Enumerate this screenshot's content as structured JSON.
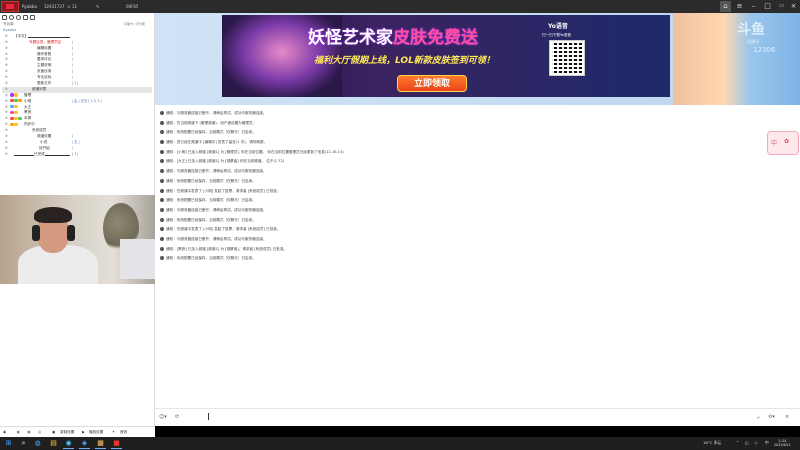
{
  "titlebar": {
    "app_name": "Ryabba",
    "channel_id": "32431737",
    "viewers": "11",
    "status_code": "00F65"
  },
  "left_panel": {
    "header_left": "节目单",
    "header_right": "平缓卡 | 不分离",
    "version": "Ryabba",
    "tree": [
      {
        "label": "【中文】",
        "indent": 12,
        "right": "",
        "red": false,
        "hl": false,
        "line": true
      },
      {
        "label": "专题目录，管理员区",
        "indent": 27,
        "right": "|",
        "red": true,
        "hl": false,
        "line": false
      },
      {
        "label": "编辑设置",
        "indent": 35,
        "right": "|",
        "red": false,
        "hl": false,
        "line": false
      },
      {
        "label": "操作参数",
        "indent": 35,
        "right": "|",
        "red": false,
        "hl": false,
        "line": false
      },
      {
        "label": "要求评论",
        "indent": 35,
        "right": "|",
        "red": false,
        "hl": false,
        "line": false
      },
      {
        "label": "主题说明",
        "indent": 35,
        "right": "|",
        "red": false,
        "hl": false,
        "line": false
      },
      {
        "label": "页面目录",
        "indent": 35,
        "right": "|",
        "red": false,
        "hl": false,
        "line": false
      },
      {
        "label": "专业目标",
        "indent": 35,
        "right": "|",
        "red": false,
        "hl": false,
        "line": false
      },
      {
        "label": "更新文件",
        "indent": 35,
        "right": "| 1 |",
        "red": false,
        "hl": false,
        "line": false
      },
      {
        "label": "频道列表",
        "indent": 30,
        "right": "",
        "red": false,
        "hl": true,
        "line": false
      },
      {
        "label": "管理",
        "indent": 22,
        "right": "",
        "red": false,
        "hl": false,
        "line": false,
        "dots": [
          "#a3f",
          "#fb2"
        ]
      },
      {
        "label": "小明",
        "indent": 22,
        "right": "| 乱 | 光文 | 1-5 人 |",
        "red": false,
        "hl": false,
        "line": false,
        "dots": [
          "#f44",
          "#4c4",
          "#f90"
        ]
      },
      {
        "label": "大王",
        "indent": 22,
        "right": "",
        "red": false,
        "hl": false,
        "line": false,
        "dots": [
          "#4af",
          "#fb2"
        ]
      },
      {
        "label": "黑夜",
        "indent": 22,
        "right": "",
        "red": false,
        "hl": false,
        "line": false,
        "dots": [
          "#e4a",
          "#fb2"
        ]
      },
      {
        "label": "本周",
        "indent": 22,
        "right": "",
        "red": false,
        "hl": false,
        "line": false,
        "dots": [
          "#f44",
          "#fb2",
          "#4c4"
        ]
      },
      {
        "label": "同步中",
        "indent": 22,
        "right": "",
        "red": false,
        "hl": false,
        "line": false,
        "dots": [
          "#f90",
          "#fb2"
        ]
      },
      {
        "label": "系统成员",
        "indent": 30,
        "right": "",
        "red": false,
        "hl": false,
        "line": false
      },
      {
        "label": "频道设置",
        "indent": 35,
        "right": "|",
        "red": false,
        "hl": false,
        "line": false
      },
      {
        "label": "小说",
        "indent": 38,
        "right": "| 文 |",
        "red": false,
        "hl": false,
        "line": false
      },
      {
        "label": "待开始",
        "indent": 37,
        "right": "|",
        "red": false,
        "hl": false,
        "line": false
      },
      {
        "label": "已完成",
        "indent": 32,
        "right": "| 1 |",
        "red": false,
        "hl": false,
        "line": true
      }
    ]
  },
  "banner": {
    "title_part1": "妖怪艺术家",
    "title_part2": "皮肤免费送",
    "subtitle": "福利大厅假期上线，LOL新款皮肤签到可领！",
    "cta": "立即领取",
    "brand": "Yo语音",
    "qr_caption": "扫一扫下载Yo语音",
    "right_logo": "斗鱼",
    "right_small": "直播间",
    "right_num": "12306"
  },
  "log": [
    "通知：与服务器连接已断开，请稍后再试。成功与服务器连接。",
    "通知：在当前频道下 (管理频道)，用户被设置为管理员。",
    "通知：系统配置已经保存，当前模式（仅聊天）已启用。",
    "通知：您已经在频道中 [编辑中] 发表了留言(1 次)，请勿刷屏。",
    "通知：[小明] 已加入频道 [频道1] 为 [管理员], 你在当前位置。  你在当前位置管理员已经更新了信息(12.16.14)",
    "通知：[大王] 已加入频道 [频道1] 为 [观察者] 你在当前频道。 位于(1.72)",
    "通知：与服务器连接已断开，请稍后再试。成功与服务器连接。",
    "通知：系统配置已经保存，当前模式（仅聊天）已启用。",
    "通知：在频道中发表了 [小明] 发起了投票，请求者 [系统成员] 已批准。",
    "通知：系统配置已经保存，当前模式（仅聊天）已启用。",
    "通知：与服务器连接已断开，请稍后再试。成功与服务器连接。",
    "通知：系统配置已经保存，当前模式（仅聊天）已启用。",
    "通知：在频道中发表了 [小明] 发起了投票，请求者 [系统成员] 已批准。",
    "通知：与服务器连接已断开，请稍后再试。成功与服务器连接。",
    "通知：[黑夜] 已加入频道 [频道1] 为 [观察者]，请求者 [系统成员] 已批准。",
    "通知：系统配置已经保存，当前模式（仅聊天）已启用。"
  ],
  "side_badge": {
    "text": "中"
  },
  "input": {
    "placeholder": ""
  },
  "bottom_bar": {
    "item1": "录制设置",
    "item2": "播放设置",
    "item3": "音效"
  },
  "taskbar": {
    "weather": "18°C 多云",
    "time": "1:24",
    "date": "2023/6/11",
    "lang": "中"
  }
}
